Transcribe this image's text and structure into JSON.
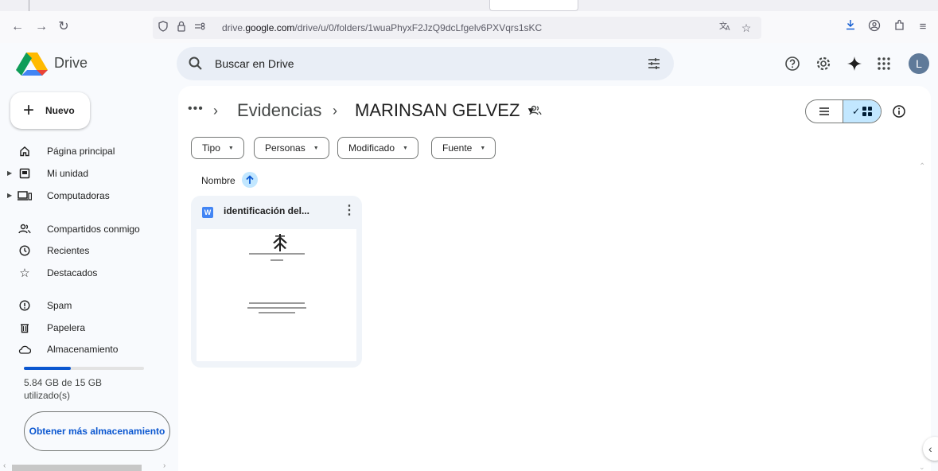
{
  "browser": {
    "url_prefix": "drive.",
    "url_domain": "google.com",
    "url_path": "/drive/u/0/folders/1wuaPhyxF2JzQ9dcLfgelv6PXVqrs1sKC"
  },
  "header": {
    "logo_text": "Drive",
    "search_placeholder": "Buscar en Drive",
    "avatar_initial": "L"
  },
  "sidebar": {
    "new_label": "Nuevo",
    "items": [
      {
        "label": "Página principal",
        "icon": "home-icon"
      },
      {
        "label": "Mi unidad",
        "icon": "drive-icon"
      },
      {
        "label": "Computadoras",
        "icon": "computer-icon"
      },
      {
        "label": "Compartidos conmigo",
        "icon": "people-icon"
      },
      {
        "label": "Recientes",
        "icon": "clock-icon"
      },
      {
        "label": "Destacados",
        "icon": "star-icon"
      },
      {
        "label": "Spam",
        "icon": "spam-icon"
      },
      {
        "label": "Papelera",
        "icon": "trash-icon"
      },
      {
        "label": "Almacenamiento",
        "icon": "cloud-icon"
      }
    ],
    "storage": {
      "text": "5.84 GB de 15 GB utilizado(s)",
      "used_fraction": 0.39
    },
    "more_storage_label": "Obtener más almacenamiento"
  },
  "main": {
    "breadcrumb": {
      "parent": "Evidencias",
      "current": "MARINSAN GELVEZ"
    },
    "filters": [
      "Tipo",
      "Personas",
      "Modificado",
      "Fuente"
    ],
    "sort_label": "Nombre",
    "files": [
      {
        "name": "identificación del...",
        "type": "W"
      }
    ]
  },
  "colors": {
    "accent": "#0b57d0",
    "selected": "#c2e7ff",
    "word_blue": "#4285f4"
  }
}
